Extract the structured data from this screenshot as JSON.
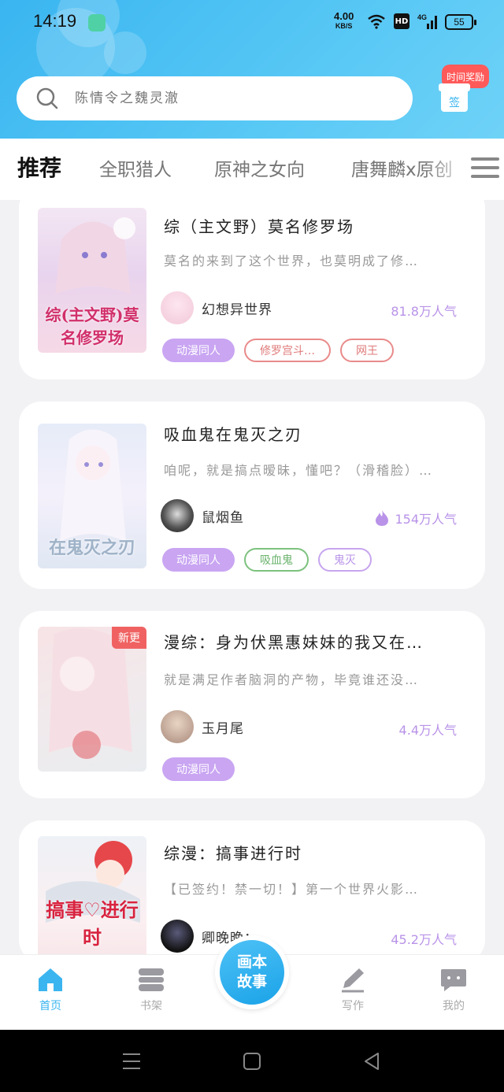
{
  "status": {
    "time": "14:19",
    "speed_value": "4.00",
    "speed_unit": "KB/S",
    "hd": "HD",
    "battery": "55"
  },
  "search": {
    "placeholder": "陈情令之魏灵澈"
  },
  "gift": {
    "tag": "时间奖励",
    "box": "签"
  },
  "tabs": [
    {
      "label": "推荐",
      "active": true
    },
    {
      "label": "全职猎人"
    },
    {
      "label": "原神之女向"
    },
    {
      "label": "唐舞麟x原创"
    }
  ],
  "books": [
    {
      "title": "综（主文野）莫名修罗场",
      "desc": "莫名的来到了这个世界，也莫明成了修…",
      "cover_text": "综(主文野)莫名修罗场",
      "author": "幻想异世界",
      "popularity": "81.8万人气",
      "hot": false,
      "update_badge": "",
      "tags": [
        {
          "label": "动漫同人",
          "style": "main"
        },
        {
          "label": "修罗宫斗…",
          "style": "red"
        },
        {
          "label": "网王",
          "style": "red"
        }
      ]
    },
    {
      "title": "吸血鬼在鬼灭之刃",
      "desc": "咱呢，就是搞点暧昧，懂吧？（滑稽脸）…",
      "cover_text": "在鬼灭之刃",
      "author": "鼠烟鱼",
      "popularity": "154万人气",
      "hot": true,
      "update_badge": "",
      "tags": [
        {
          "label": "动漫同人",
          "style": "main"
        },
        {
          "label": "吸血鬼",
          "style": "green"
        },
        {
          "label": "鬼灭",
          "style": "purple"
        }
      ]
    },
    {
      "title": "漫综：身为伏黑惠妹妹的我又在…",
      "desc": "就是满足作者脑洞的产物，毕竟谁还没…",
      "cover_text": "",
      "author": "玉月尾",
      "popularity": "4.4万人气",
      "hot": false,
      "update_badge": "新更",
      "tags": [
        {
          "label": "动漫同人",
          "style": "main"
        }
      ]
    },
    {
      "title": "综漫：搞事进行时",
      "desc": "【已签约！禁一切！】第一个世界火影…",
      "cover_text": "搞事♡进行时",
      "author": "卿晚晚：",
      "popularity": "45.2万人气",
      "hot": false,
      "update_badge": "",
      "tags": []
    }
  ],
  "nav": {
    "home": "首页",
    "shelf": "书架",
    "center": "画本故事",
    "write": "写作",
    "mine": "我的"
  },
  "colors": {
    "accent": "#3ab5f0",
    "purple": "#b993e8",
    "tag_main": "#c9a5f2"
  }
}
